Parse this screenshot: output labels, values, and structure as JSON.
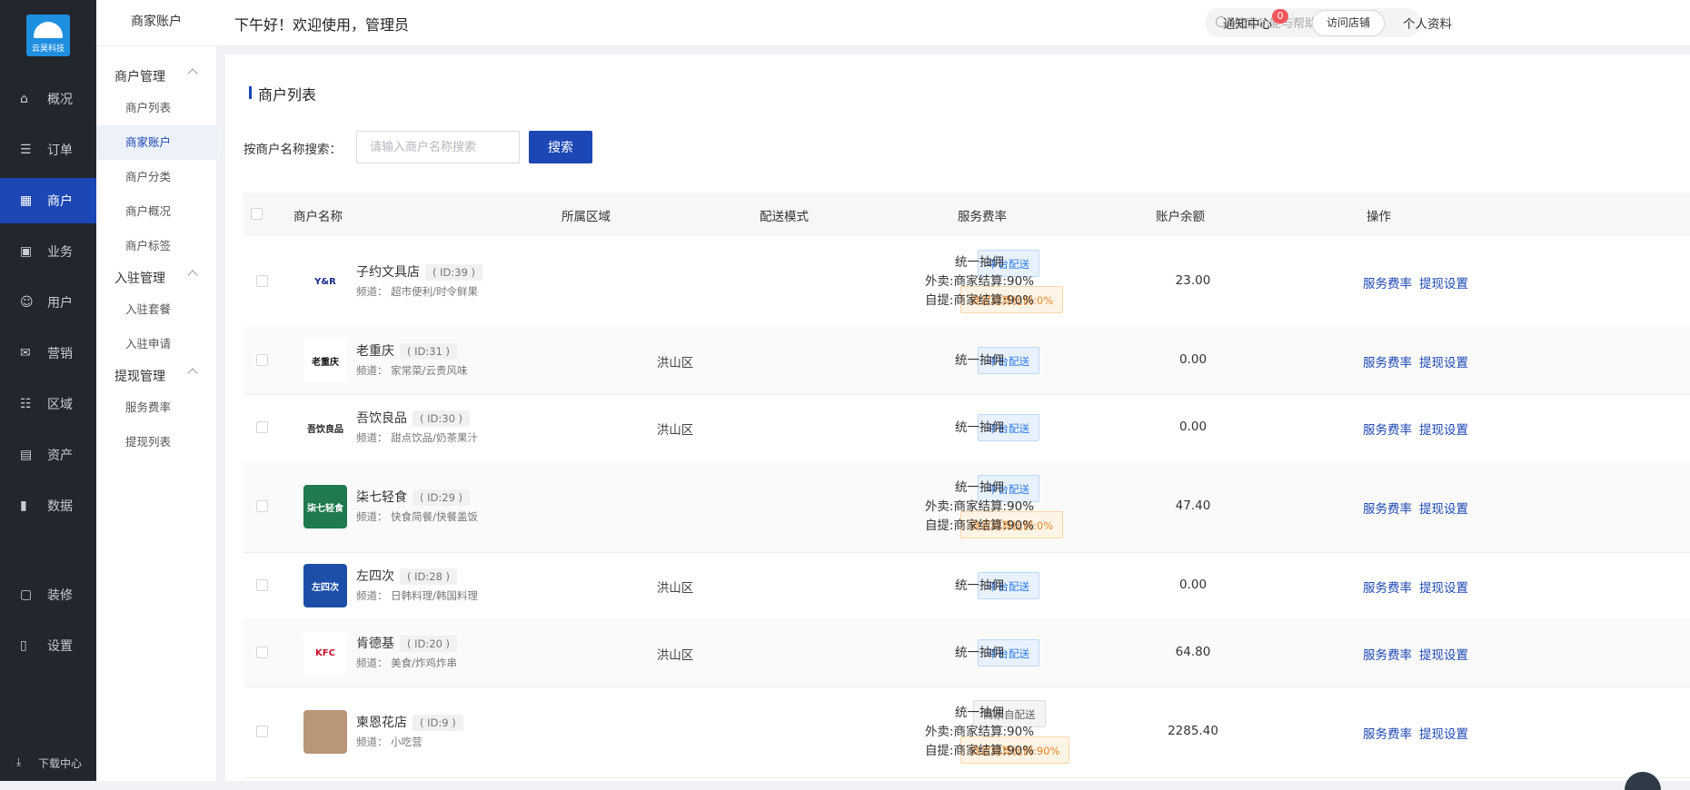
{
  "nav": {
    "logo_text": "云昊科技",
    "items": [
      {
        "label": "概况",
        "icon": "dashboard-icon"
      },
      {
        "label": "订单",
        "icon": "order-icon"
      },
      {
        "label": "商户",
        "icon": "merchant-icon",
        "active": true
      },
      {
        "label": "业务",
        "icon": "business-icon"
      },
      {
        "label": "用户",
        "icon": "user-icon"
      },
      {
        "label": "营销",
        "icon": "marketing-icon"
      },
      {
        "label": "区域",
        "icon": "region-icon"
      },
      {
        "label": "资产",
        "icon": "asset-icon"
      },
      {
        "label": "数据",
        "icon": "data-icon"
      },
      {
        "label": "装修",
        "icon": "decorate-icon"
      },
      {
        "label": "设置",
        "icon": "settings-icon"
      }
    ],
    "download_label": "下载中心"
  },
  "submenu": {
    "title": "商家账户",
    "groups": [
      {
        "label": "商户管理",
        "items": [
          "商户列表",
          "商家账户",
          "商户分类",
          "商户概况",
          "商户标签"
        ]
      },
      {
        "label": "入驻管理",
        "items": [
          "入驻套餐",
          "入驻申请"
        ]
      },
      {
        "label": "提现管理",
        "items": [
          "服务费率",
          "提现列表"
        ]
      }
    ],
    "active_item": "商家账户"
  },
  "header": {
    "greeting": "下午好！欢迎使用，管理员",
    "search_placeholder": "搜索功能与帮助",
    "notice_label": "通知中心",
    "notice_count": "0",
    "visit_store_label": "访问店铺",
    "profile_label": "个人资料"
  },
  "page": {
    "title": "商户列表",
    "search_label": "按商户名称搜索：",
    "search_placeholder": "请输入商户名称搜索",
    "search_button": "搜索"
  },
  "table": {
    "columns": [
      "商户名称",
      "所属区域",
      "配送模式",
      "服务费率",
      "账户余额",
      "操作"
    ],
    "rows": [
      {
        "name": "子约文具店",
        "id": "( ID:39 )",
        "category": "频道： 超市便利/时令鲜果",
        "area": "",
        "mode": "平台配送",
        "mode_color": "blue",
        "ratio": "商家结算比例:0%",
        "fee": [
          "统一抽佣",
          "外卖:商家结算:90%",
          "自提:商家结算:90%"
        ],
        "balance": "23.00",
        "ops": [
          "服务费率",
          "提现设置"
        ]
      },
      {
        "name": "老重庆",
        "id": "( ID:31 )",
        "category": "频道： 家常菜/云贵风味",
        "area": "洪山区",
        "mode": "平台配送",
        "mode_color": "blue",
        "ratio": "",
        "fee": [
          "统一抽佣"
        ],
        "balance": "0.00",
        "ops": [
          "服务费率",
          "提现设置"
        ]
      },
      {
        "name": "吾饮良品",
        "id": "( ID:30 )",
        "category": "频道： 甜点饮品/奶茶果汁",
        "area": "洪山区",
        "mode": "平台配送",
        "mode_color": "blue",
        "ratio": "",
        "fee": [
          "统一抽佣"
        ],
        "balance": "0.00",
        "ops": [
          "服务费率",
          "提现设置"
        ]
      },
      {
        "name": "柒七轻食",
        "id": "( ID:29 )",
        "category": "频道： 快食简餐/快餐盖饭",
        "area": "",
        "mode": "平台配送",
        "mode_color": "blue",
        "ratio": "商家结算比例:0%",
        "fee": [
          "统一抽佣",
          "外卖:商家结算:90%",
          "自提:商家结算:90%"
        ],
        "balance": "47.40",
        "ops": [
          "服务费率",
          "提现设置"
        ]
      },
      {
        "name": "左四次",
        "id": "( ID:28 )",
        "category": "频道： 日韩料理/韩国料理",
        "area": "洪山区",
        "mode": "平台配送",
        "mode_color": "blue",
        "ratio": "",
        "fee": [
          "统一抽佣"
        ],
        "balance": "0.00",
        "ops": [
          "服务费率",
          "提现设置"
        ]
      },
      {
        "name": "肯德基",
        "id": "( ID:20 )",
        "category": "频道： 美食/炸鸡炸串",
        "area": "洪山区",
        "mode": "平台配送",
        "mode_color": "blue",
        "ratio": "",
        "fee": [
          "统一抽佣"
        ],
        "balance": "64.80",
        "ops": [
          "服务费率",
          "提现设置"
        ]
      },
      {
        "name": "柬恩花店",
        "id": "( ID:9 )",
        "category": "频道： 小吃营",
        "area": "",
        "mode": "商家自配送",
        "mode_color": "gray",
        "ratio": "商家结算比例:90%",
        "fee": [
          "统一抽佣",
          "外卖:商家结算:90%",
          "自提:商家结算:90%"
        ],
        "balance": "2285.40",
        "ops": [
          "服务费率",
          "提现设置"
        ]
      }
    ],
    "logos": [
      {
        "text": "Y&R",
        "bg": "#ffffff",
        "fg": "#1a2a8a"
      },
      {
        "text": "老重庆",
        "bg": "#ffffff",
        "fg": "#111111"
      },
      {
        "text": "吾饮良品",
        "bg": "#ffffff",
        "fg": "#222222"
      },
      {
        "text": "柒七轻食",
        "bg": "#1f7a4d",
        "fg": "#ffffff"
      },
      {
        "text": "左四次",
        "bg": "#1d4fa8",
        "fg": "#ffffff"
      },
      {
        "text": "KFC",
        "bg": "#ffffff",
        "fg": "#c8102e"
      },
      {
        "text": "",
        "bg": "#b89677",
        "fg": "#ffffff"
      }
    ]
  },
  "colors": {
    "primary": "#1c47b4",
    "nav_bg": "#23262d",
    "badge": "#f5555c"
  }
}
